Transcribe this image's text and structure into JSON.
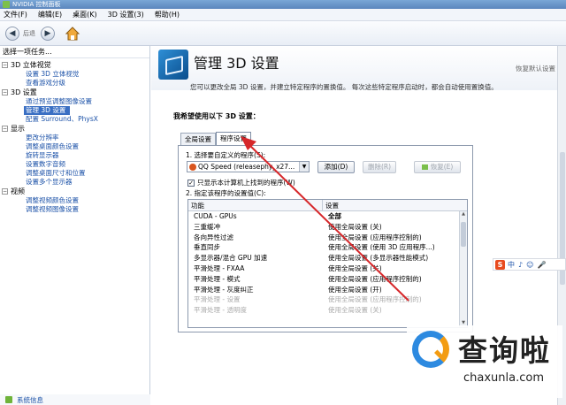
{
  "window": {
    "title": "NVIDIA 控制面板"
  },
  "menu": [
    "文件(F)",
    "编辑(E)",
    "桌面(K)",
    "3D 设置(3)",
    "帮助(H)"
  ],
  "toolbar": {
    "back_label": "后退"
  },
  "left": {
    "task_header": "选择一项任务...",
    "tree": [
      {
        "label": "3D 立体视觉",
        "items": [
          {
            "label": "设置 3D 立体视觉"
          },
          {
            "label": "查看游戏分级"
          }
        ]
      },
      {
        "label": "3D 设置",
        "items": [
          {
            "label": "通过预览调整图像设置"
          },
          {
            "label": "管理 3D 设置",
            "selected": true
          },
          {
            "label": "配置 Surround、PhysX"
          }
        ]
      },
      {
        "label": "显示",
        "items": [
          {
            "label": "更改分辨率"
          },
          {
            "label": "调整桌面颜色设置"
          },
          {
            "label": "旋转显示器"
          },
          {
            "label": "设置数字音频"
          },
          {
            "label": "调整桌面尺寸和位置"
          },
          {
            "label": "设置多个显示器"
          }
        ]
      },
      {
        "label": "视频",
        "items": [
          {
            "label": "调整视频颜色设置"
          },
          {
            "label": "调整视频图像设置"
          }
        ]
      }
    ],
    "system_info": "系统信息"
  },
  "main": {
    "title": "管理 3D 设置",
    "restore_defaults": "恢复默认设置",
    "description": "您可以更改全局 3D 设置，并建立特定程序的置换值。 每次这些特定程序启动时，都会自动使用置换值。",
    "section_title": "我希望使用以下 3D 设置：",
    "tabs": [
      {
        "label": "全局设置"
      },
      {
        "label": "程序设置",
        "active": true
      }
    ],
    "step1_label": "1. 选择要自定义的程序(S):",
    "program_selected": "QQ Speed (releasephy_x27...",
    "add_button": "添加(D)",
    "remove_button": "删除(R)",
    "restore_button": "恢复(E)",
    "checkbox_label": "只显示本计算机上找到的程序(W)",
    "checkbox_checked": true,
    "step2_label": "2. 指定该程序的设置值(C):",
    "grid_headers": {
      "feature": "功能",
      "setting": "设置"
    },
    "grid_rows": [
      {
        "feature": "CUDA - GPUs",
        "setting": "全部",
        "bold": true
      },
      {
        "feature": "三重缓冲",
        "setting": "使用全局设置 (关)"
      },
      {
        "feature": "各向异性过滤",
        "setting": "使用全局设置 (应用程序控制的)"
      },
      {
        "feature": "垂直同步",
        "setting": "使用全局设置 (使用 3D 应用程序...)"
      },
      {
        "feature": "多显示器/混合 GPU 加速",
        "setting": "使用全局设置 (多显示器性能模式)"
      },
      {
        "feature": "平滑处理 - FXAA",
        "setting": "使用全局设置 (关)"
      },
      {
        "feature": "平滑处理 - 模式",
        "setting": "使用全局设置 (应用程序控制的)"
      },
      {
        "feature": "平滑处理 - 灰度纠正",
        "setting": "使用全局设置 (开)"
      },
      {
        "feature": "平滑处理 - 设置",
        "setting": "使用全局设置 (应用程序控制的)",
        "faded": true
      },
      {
        "feature": "平滑处理 - 透明度",
        "setting": "使用全局设置 (关)",
        "faded": true
      }
    ]
  },
  "ime": {
    "logo": "S",
    "items": [
      "中",
      "♪",
      "☺",
      "🎤"
    ]
  },
  "watermark": {
    "brand": "查询啦",
    "url": "chaxunla.com"
  }
}
